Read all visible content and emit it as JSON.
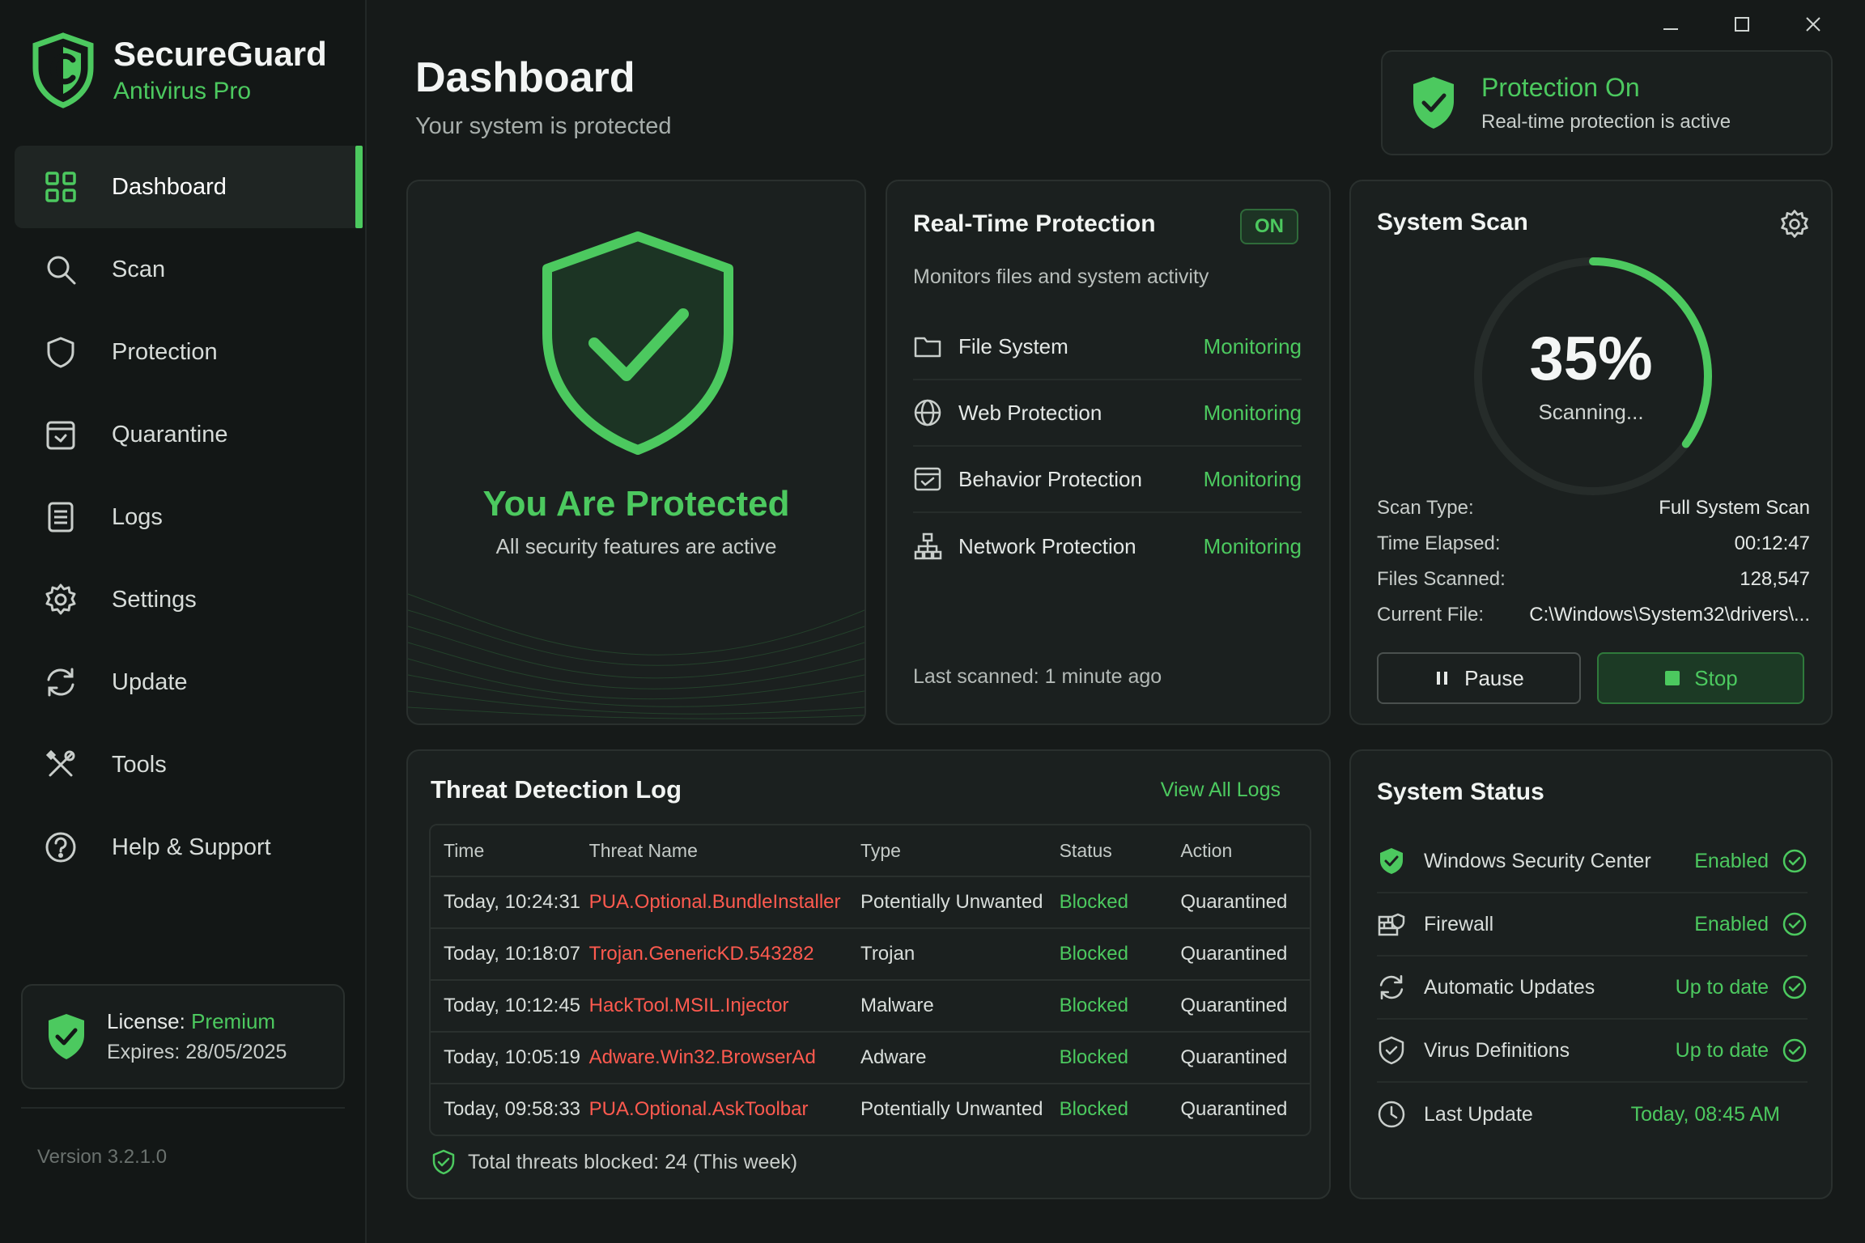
{
  "brand": {
    "name": "SecureGuard",
    "subtitle": "Antivirus Pro"
  },
  "nav": [
    {
      "label": "Dashboard",
      "icon": "grid-icon",
      "active": true
    },
    {
      "label": "Scan",
      "icon": "search-icon"
    },
    {
      "label": "Protection",
      "icon": "shield-icon"
    },
    {
      "label": "Quarantine",
      "icon": "quarantine-box-icon"
    },
    {
      "label": "Logs",
      "icon": "document-icon"
    },
    {
      "label": "Settings",
      "icon": "gear-icon"
    },
    {
      "label": "Update",
      "icon": "refresh-icon"
    },
    {
      "label": "Tools",
      "icon": "tools-icon"
    },
    {
      "label": "Help & Support",
      "icon": "help-icon"
    }
  ],
  "license": {
    "label": "License:",
    "tier": "Premium",
    "expires": "Expires: 28/05/2025"
  },
  "version": "Version 3.2.1.0",
  "header": {
    "title": "Dashboard",
    "subtitle": "Your system is protected"
  },
  "protection_pill": {
    "title": "Protection On",
    "subtitle": "Real-time protection is active"
  },
  "protected_card": {
    "title": "You Are Protected",
    "subtitle": "All security features are active"
  },
  "realtime": {
    "title": "Real-Time Protection",
    "badge": "ON",
    "description": "Monitors files and system activity",
    "items": [
      {
        "name": "File System",
        "status": "Monitoring",
        "icon": "folder-icon"
      },
      {
        "name": "Web Protection",
        "status": "Monitoring",
        "icon": "globe-icon"
      },
      {
        "name": "Behavior Protection",
        "status": "Monitoring",
        "icon": "behavior-icon"
      },
      {
        "name": "Network Protection",
        "status": "Monitoring",
        "icon": "network-icon"
      }
    ],
    "last_scanned": "Last scanned: 1 minute ago"
  },
  "scan": {
    "title": "System Scan",
    "percent_label": "35%",
    "progress": 0.35,
    "state": "Scanning...",
    "info": [
      {
        "key": "Scan Type:",
        "value": "Full System Scan"
      },
      {
        "key": "Time Elapsed:",
        "value": "00:12:47"
      },
      {
        "key": "Files Scanned:",
        "value": "128,547"
      },
      {
        "key": "Current File:",
        "value": "C:\\Windows\\System32\\drivers\\..."
      }
    ],
    "pause_label": "Pause",
    "stop_label": "Stop"
  },
  "threat_log": {
    "title": "Threat Detection Log",
    "view_all": "View All Logs",
    "columns": [
      "Time",
      "Threat Name",
      "Type",
      "Status",
      "Action"
    ],
    "rows": [
      [
        "Today, 10:24:31",
        "PUA.Optional.BundleInstaller",
        "Potentially Unwanted",
        "Blocked",
        "Quarantined"
      ],
      [
        "Today, 10:18:07",
        "Trojan.GenericKD.543282",
        "Trojan",
        "Blocked",
        "Quarantined"
      ],
      [
        "Today, 10:12:45",
        "HackTool.MSIL.Injector",
        "Malware",
        "Blocked",
        "Quarantined"
      ],
      [
        "Today, 10:05:19",
        "Adware.Win32.BrowserAd",
        "Adware",
        "Blocked",
        "Quarantined"
      ],
      [
        "Today, 09:58:33",
        "PUA.Optional.AskToolbar",
        "Potentially Unwanted",
        "Blocked",
        "Quarantined"
      ]
    ],
    "total": "Total threats blocked: 24 (This week)"
  },
  "system_status": {
    "title": "System Status",
    "items": [
      {
        "name": "Windows Security Center",
        "value": "Enabled",
        "icon": "shield-check-icon"
      },
      {
        "name": "Firewall",
        "value": "Enabled",
        "icon": "firewall-icon"
      },
      {
        "name": "Automatic Updates",
        "value": "Up to date",
        "icon": "refresh-icon"
      },
      {
        "name": "Virus Definitions",
        "value": "Up to date",
        "icon": "shield-check-outline-icon"
      },
      {
        "name": "Last Update",
        "value": "Today, 08:45 AM",
        "icon": "clock-icon"
      }
    ]
  },
  "colors": {
    "accent": "#4cc95f",
    "danger": "#ff5a4f",
    "background": "#161a19",
    "card": "#1b201f"
  }
}
